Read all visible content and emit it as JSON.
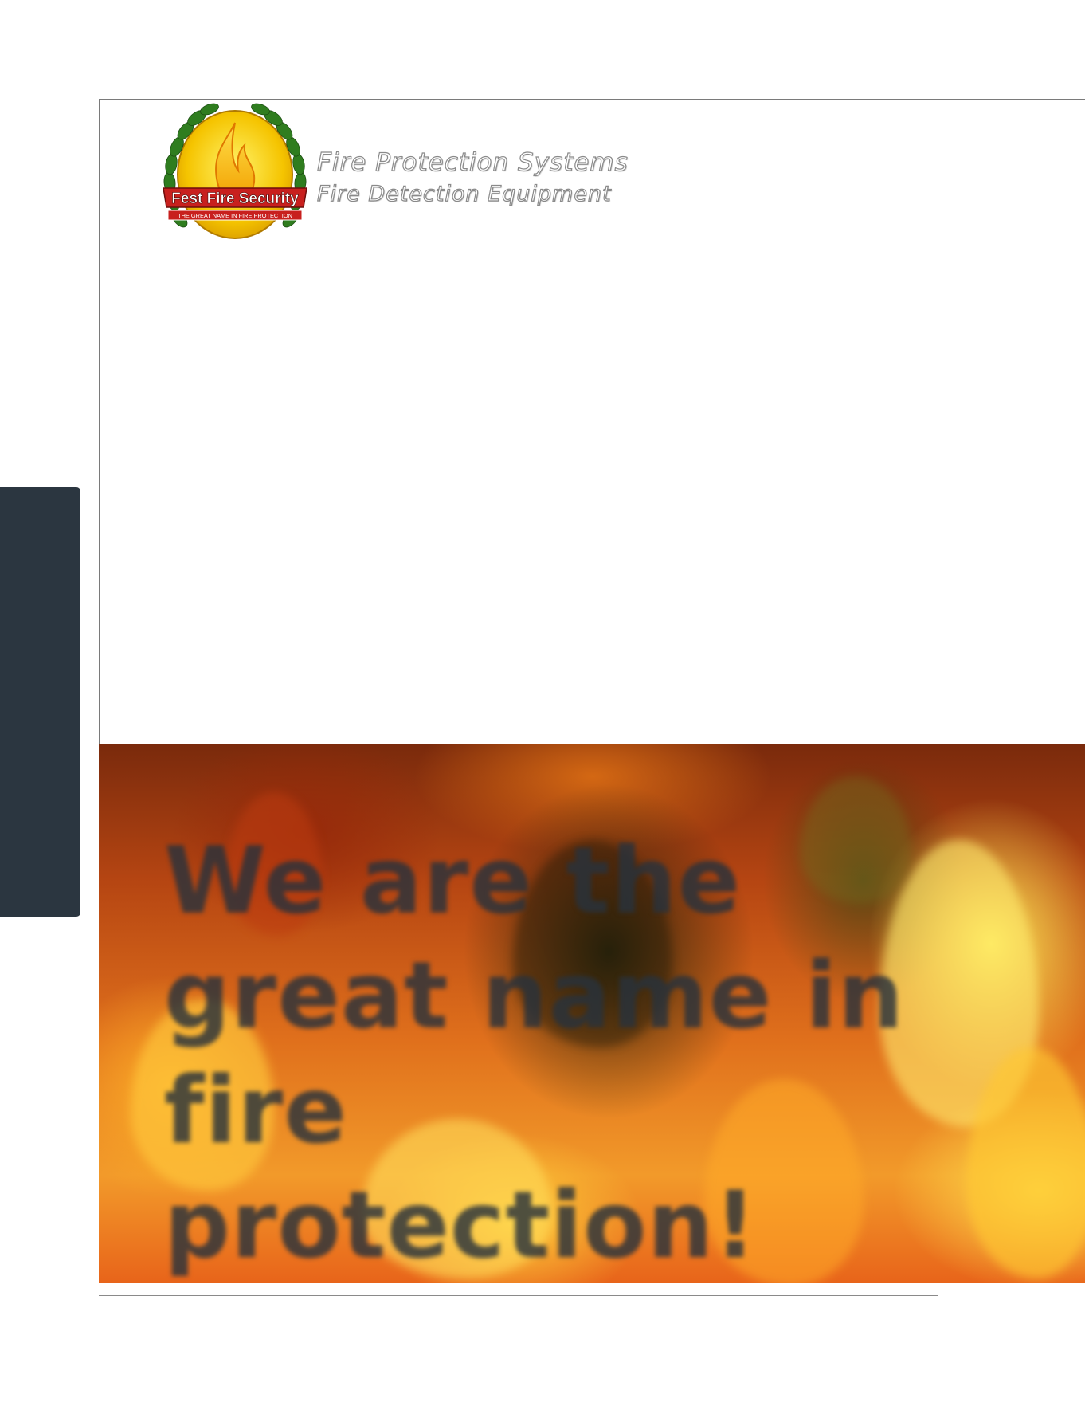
{
  "brand": {
    "logo_name": "Fest Fire Security",
    "logo_motto": "THE GREAT NAME IN FIRE PROTECTION"
  },
  "header": {
    "tagline_1": "Fire Protection Systems",
    "tagline_2": "Fire Detection Equipment"
  },
  "banner": {
    "line_1": "We are the",
    "line_2": "great name in",
    "line_3": "fire protection!"
  },
  "colors": {
    "side_tab": "#2b3640",
    "logo_red": "#c8201e",
    "logo_gold": "#f5c400",
    "logo_green": "#2f7d1f",
    "banner_text": "#28323c"
  }
}
